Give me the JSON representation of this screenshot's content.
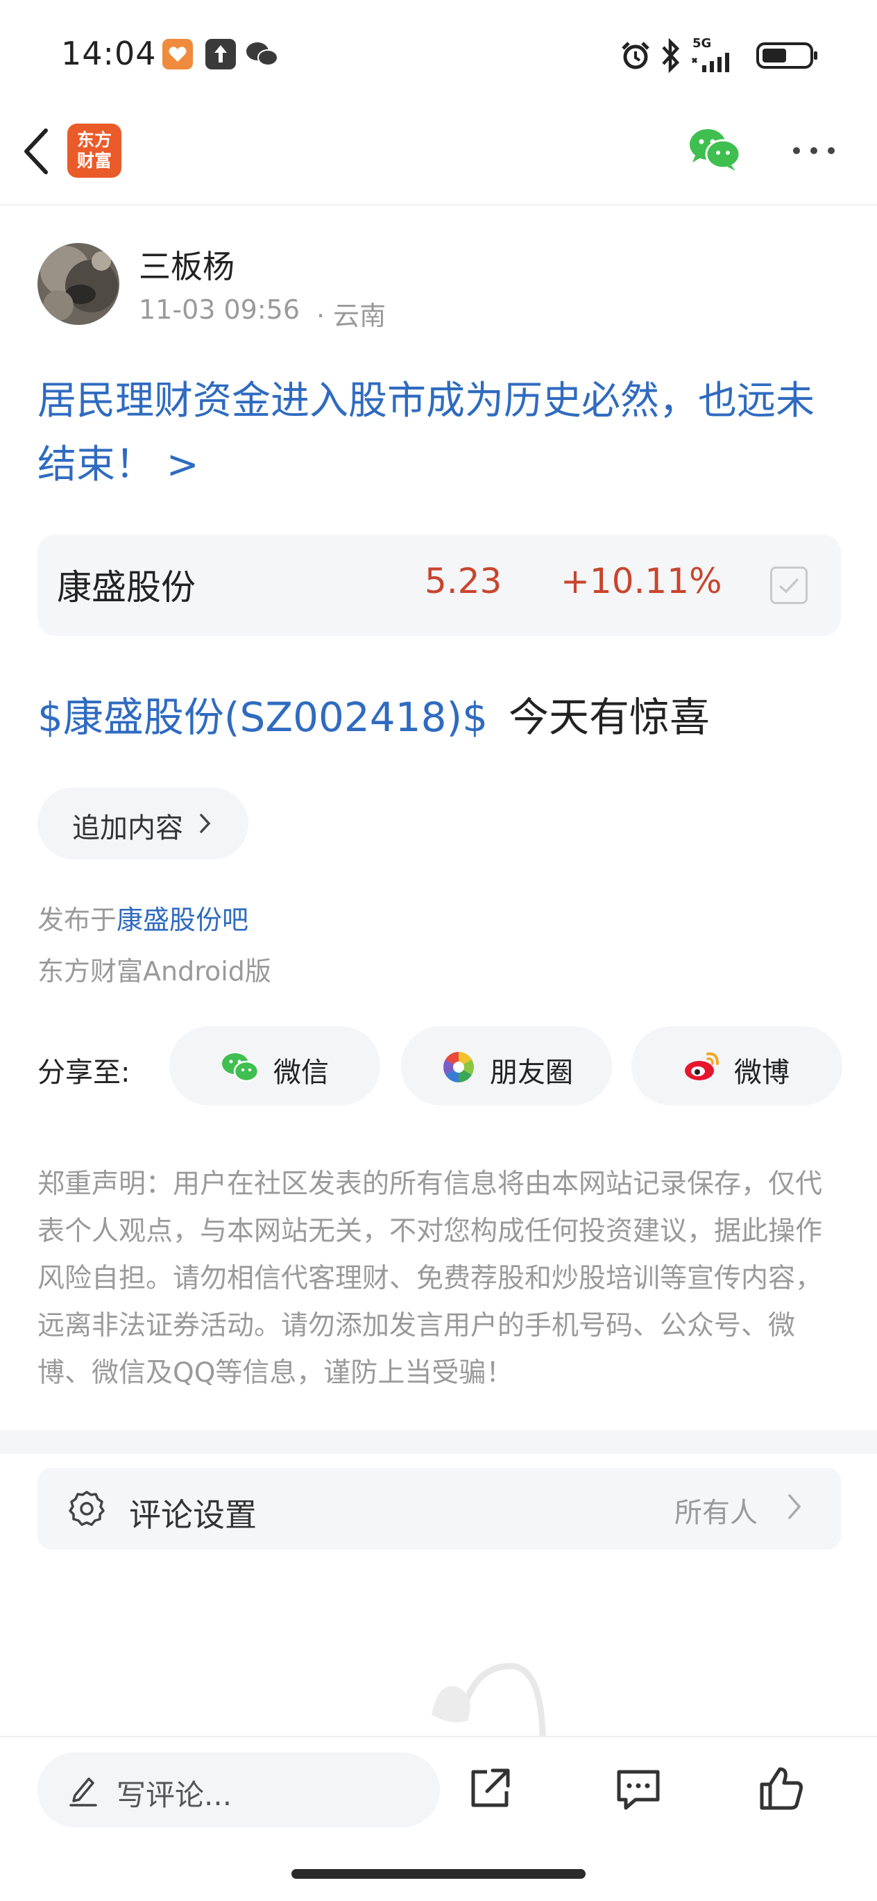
{
  "status_bar": {
    "time": "14:04",
    "network": "5G"
  },
  "header": {
    "logo_text": "东方财富",
    "logo_color": "#ea5b2a"
  },
  "author": {
    "name": "三板杨",
    "time": "11-03 09:56",
    "location": "· 云南"
  },
  "post": {
    "title": "居民理财资金进入股市成为历史必然，也远未结束！ >",
    "stock": {
      "name": "康盛股份",
      "price": "5.23",
      "change": "+10.11%"
    },
    "body_link": "$康盛股份(SZ002418)$",
    "body_text": "今天有惊喜",
    "append_label": "追加内容",
    "published_prefix": "发布于",
    "published_bar": "康盛股份吧",
    "client": "东方财富Android版"
  },
  "share": {
    "label": "分享至:",
    "items": [
      {
        "label": "微信",
        "icon": "wechat-icon"
      },
      {
        "label": "朋友圈",
        "icon": "moments-icon"
      },
      {
        "label": "微博",
        "icon": "weibo-icon"
      }
    ]
  },
  "disclaimer": "郑重声明：用户在社区发表的所有信息将由本网站记录保存，仅代表个人观点，与本网站无关，不对您构成任何投资建议，据此操作风险自担。请勿相信代客理财、免费荐股和炒股培训等宣传内容，远离非法证券活动。请勿添加发言用户的手机号码、公众号、微博、微信及QQ等信息，谨防上当受骗！",
  "comment_settings": {
    "label": "评论设置",
    "value": "所有人"
  },
  "bottom_bar": {
    "comment_placeholder": "写评论..."
  },
  "colors": {
    "link_blue": "#2f6bc0",
    "price_red": "#c8452e",
    "wechat_green": "#3fbf4f"
  }
}
